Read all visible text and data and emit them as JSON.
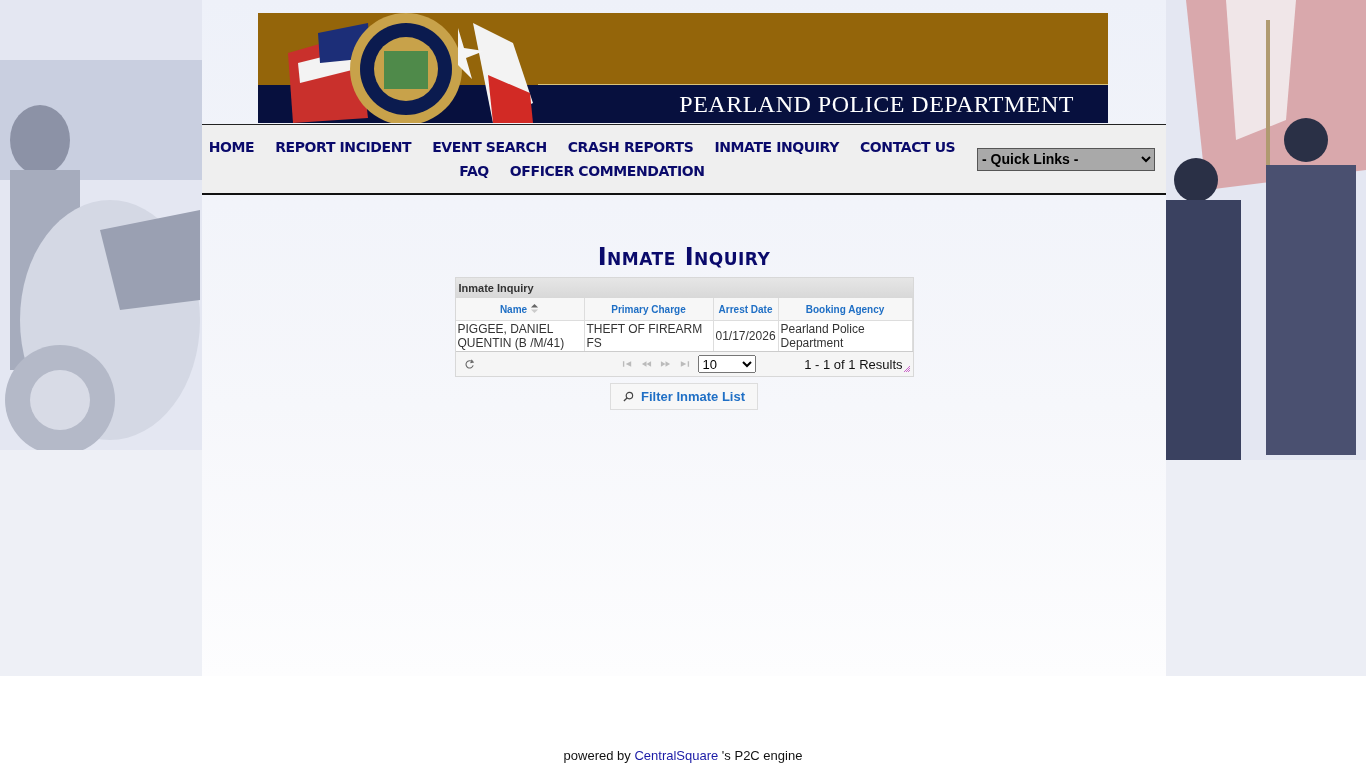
{
  "banner": {
    "title": "PEARLAND POLICE DEPARTMENT"
  },
  "nav": {
    "links": [
      "HOME",
      "REPORT INCIDENT",
      "EVENT SEARCH",
      "CRASH REPORTS",
      "INMATE INQUIRY",
      "CONTACT US",
      "FAQ",
      "OFFICER COMMENDATION"
    ],
    "quick_links": "- Quick Links -"
  },
  "page_title": "Inmate Inquiry",
  "grid": {
    "caption": "Inmate Inquiry",
    "columns": [
      {
        "label": "Name",
        "sorted": true
      },
      {
        "label": "Primary Charge",
        "sorted": false
      },
      {
        "label": "Arrest Date",
        "sorted": false
      },
      {
        "label": "Booking Agency",
        "sorted": false
      }
    ],
    "rows": [
      [
        "PIGGEE, DANIEL QUENTIN (B /M/41)",
        "THEFT OF FIREARM FS",
        "01/17/2026",
        "Pearland Police Department"
      ]
    ],
    "pager": {
      "page_size": "10",
      "summary": "1 - 1 of 1 Results"
    }
  },
  "filter_button": "Filter Inmate List",
  "footer": {
    "prefix": "powered by",
    "link": "CentralSquare",
    "suffix": "'s P2C engine"
  }
}
